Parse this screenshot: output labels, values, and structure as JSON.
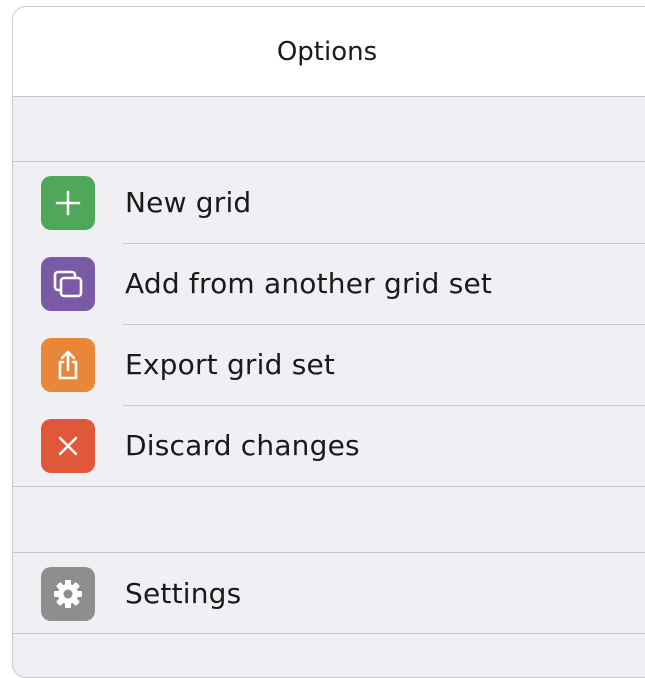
{
  "header": {
    "title": "Options"
  },
  "menu": {
    "items": [
      {
        "label": "New grid",
        "icon": "plus-icon",
        "color": "#4fa85a"
      },
      {
        "label": "Add from another grid set",
        "icon": "copy-icon",
        "color": "#7a5aa6"
      },
      {
        "label": "Export grid set",
        "icon": "share-icon",
        "color": "#e8873a"
      },
      {
        "label": "Discard changes",
        "icon": "close-icon",
        "color": "#e0573a"
      }
    ]
  },
  "settings": {
    "label": "Settings",
    "icon": "gear-icon",
    "color": "#8e8e8e"
  }
}
